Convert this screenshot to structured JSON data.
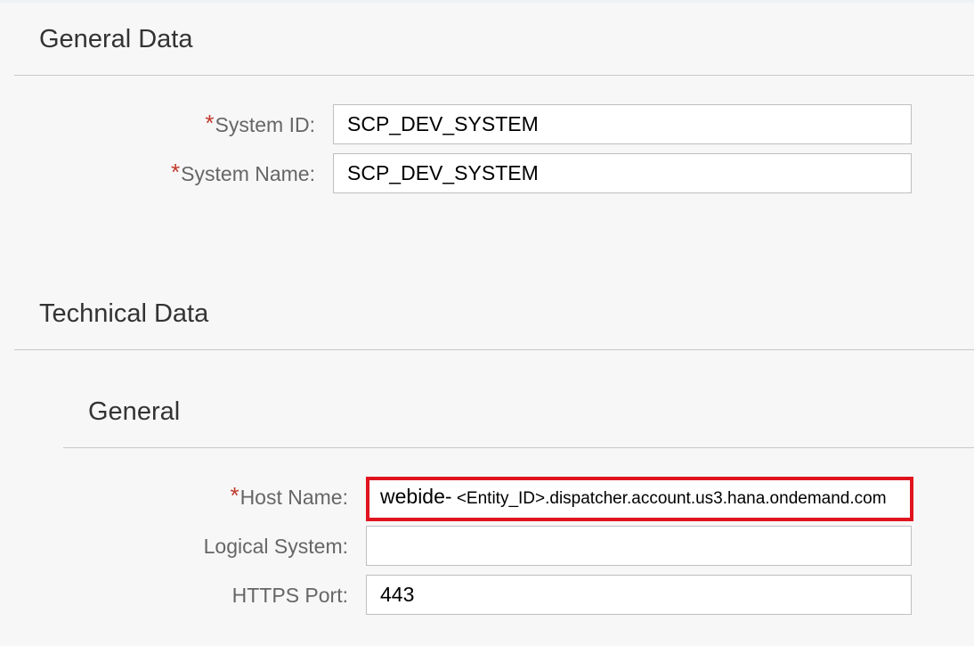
{
  "general_data": {
    "title": "General Data",
    "fields": [
      {
        "label": "System ID:",
        "required": true,
        "value": "SCP_DEV_SYSTEM"
      },
      {
        "label": "System Name:",
        "required": true,
        "value": "SCP_DEV_SYSTEM"
      }
    ]
  },
  "technical_data": {
    "title": "Technical Data",
    "general": {
      "title": "General",
      "host_name": {
        "label": "Host Name:",
        "required": true,
        "value_prefix": "webide-",
        "value_rest": " <Entity_ID>.dispatcher.account.us3.hana.ondemand.com"
      },
      "logical_system": {
        "label": "Logical System:",
        "required": false,
        "value": ""
      },
      "https_port": {
        "label": "HTTPS Port:",
        "required": false,
        "value": "443"
      }
    }
  },
  "required_marker": "*",
  "colors": {
    "required": "#c0392b",
    "highlight_border": "#e0141e",
    "background": "#f7f7f7"
  }
}
